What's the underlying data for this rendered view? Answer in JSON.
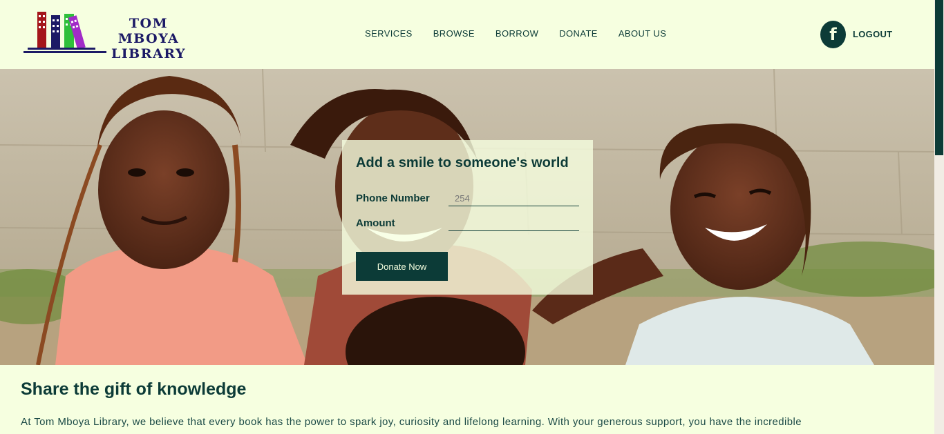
{
  "brand": {
    "line1": "TOM MBOYA",
    "line2": "LIBRARY",
    "logo_icon": "books-icon",
    "colors": {
      "red": "#a4161a",
      "blue": "#1c1a66",
      "green": "#2fbf3b",
      "purple": "#a12bc7"
    }
  },
  "nav": {
    "services": "SERVICES",
    "browse": "BROWSE",
    "borrow": "BORROW",
    "donate": "DONATE",
    "about": "ABOUT US"
  },
  "header": {
    "facebook_icon": "facebook-icon",
    "facebook_glyph": "f",
    "logout": "LOGOUT"
  },
  "donate_form": {
    "title": "Add a smile to someone's world",
    "phone_label": "Phone Number",
    "phone_placeholder": "254",
    "amount_label": "Amount",
    "amount_value": "",
    "button": "Donate Now"
  },
  "content": {
    "title": "Share the gift of knowledge",
    "text": "At Tom Mboya Library, we believe that every book has the power to spark joy, curiosity and lifelong learning. With your generous support, you have the incredible"
  },
  "theme": {
    "primary": "#0c3b37",
    "background": "#f6ffe0"
  }
}
